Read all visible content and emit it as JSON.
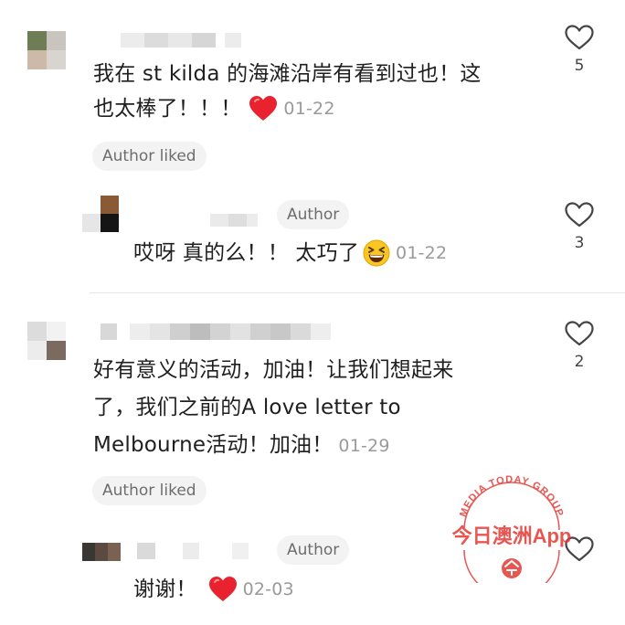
{
  "comments": [
    {
      "text_line1": "我在 st kilda 的海滩沿岸有看到过也！这",
      "text_line2": "也太棒了！！！",
      "emoji": "red-heart",
      "date": "01-22",
      "badge": "Author liked",
      "likes": "5"
    },
    {
      "tag": "Author",
      "text": "哎呀 真的么！！ 太巧了",
      "emoji": "grinning-squinting-face",
      "date": "01-22",
      "likes": "3"
    },
    {
      "text_line1": "好有意义的活动，加油！让我们想起来",
      "text_line2": "了，我们之前的A love letter to",
      "text_line3": "Melbourne活动！加油！",
      "date": "01-29",
      "badge": "Author liked",
      "likes": "2"
    },
    {
      "tag": "Author",
      "text": "谢谢！",
      "emoji": "red-heart",
      "date": "02-03"
    }
  ],
  "watermark": {
    "arc_text": "MEDIA TODAY GROUP",
    "brand": "今日澳洲App",
    "colors": {
      "brand": "#e53935"
    }
  },
  "colors": {
    "text": "#1f1f1f",
    "date": "#9a9a9a",
    "pill_bg": "#f3f3f3",
    "heart_stroke": "#444444",
    "emoji_heart": "#e8232f"
  }
}
